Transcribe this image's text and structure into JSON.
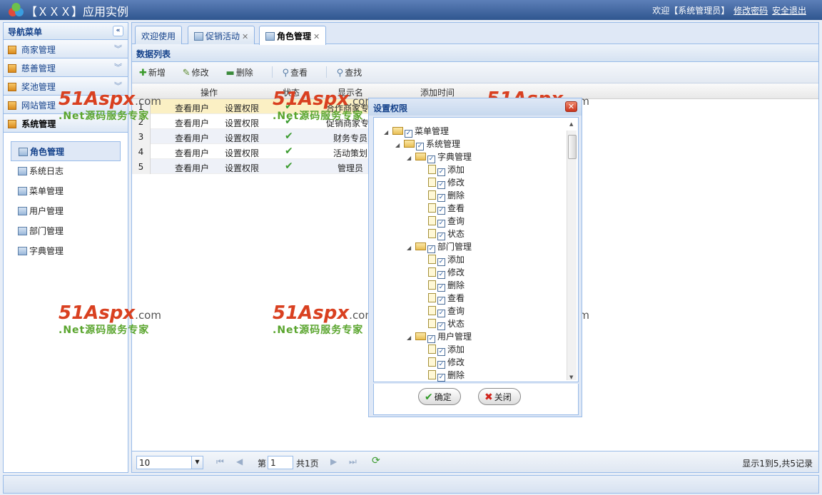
{
  "header": {
    "title": "【ＸＸＸ】应用实例",
    "welcome": "欢迎【系统管理员】",
    "change_password": "修改密码",
    "logout": "安全退出"
  },
  "west": {
    "title": "导航菜单",
    "accordion": [
      {
        "label": "商家管理"
      },
      {
        "label": "慈善管理"
      },
      {
        "label": "奖池管理"
      },
      {
        "label": "网站管理"
      },
      {
        "label": "系统管理"
      }
    ],
    "submenu": [
      {
        "label": "角色管理"
      },
      {
        "label": "系统日志"
      },
      {
        "label": "菜单管理"
      },
      {
        "label": "用户管理"
      },
      {
        "label": "部门管理"
      },
      {
        "label": "字典管理"
      }
    ]
  },
  "tabs": [
    {
      "label": "欢迎使用"
    },
    {
      "label": "促销活动"
    },
    {
      "label": "角色管理"
    }
  ],
  "panel": {
    "title": "数据列表"
  },
  "toolbar": {
    "add": "新增",
    "edit": "修改",
    "delete": "删除",
    "view": "查看",
    "search": "查找"
  },
  "grid": {
    "columns": {
      "op": "操作",
      "status": "状态",
      "name": "显示名",
      "time": "添加时间"
    },
    "rows": [
      {
        "num": "1",
        "view_users": "查看用户",
        "set_perm": "设置权限",
        "name": "合作商家专"
      },
      {
        "num": "2",
        "view_users": "查看用户",
        "set_perm": "设置权限",
        "name": "促销商家专"
      },
      {
        "num": "3",
        "view_users": "查看用户",
        "set_perm": "设置权限",
        "name": "财务专员"
      },
      {
        "num": "4",
        "view_users": "查看用户",
        "set_perm": "设置权限",
        "name": "活动策划"
      },
      {
        "num": "5",
        "view_users": "查看用户",
        "set_perm": "设置权限",
        "name": "管理员"
      }
    ]
  },
  "pager": {
    "page_size": "10",
    "page_prefix": "第",
    "current_page": "1",
    "page_suffix": "共1页",
    "summary": "显示1到5,共5记录"
  },
  "dialog": {
    "title": "设置权限",
    "tree": [
      {
        "label": "菜单管理",
        "level": 0,
        "type": "folder"
      },
      {
        "label": "系统管理",
        "level": 1,
        "type": "folder"
      },
      {
        "label": "字典管理",
        "level": 2,
        "type": "folder"
      },
      {
        "label": "添加",
        "level": 3,
        "type": "file"
      },
      {
        "label": "修改",
        "level": 3,
        "type": "file"
      },
      {
        "label": "删除",
        "level": 3,
        "type": "file"
      },
      {
        "label": "查看",
        "level": 3,
        "type": "file"
      },
      {
        "label": "查询",
        "level": 3,
        "type": "file"
      },
      {
        "label": "状态",
        "level": 3,
        "type": "file"
      },
      {
        "label": "部门管理",
        "level": 2,
        "type": "folder"
      },
      {
        "label": "添加",
        "level": 3,
        "type": "file"
      },
      {
        "label": "修改",
        "level": 3,
        "type": "file"
      },
      {
        "label": "删除",
        "level": 3,
        "type": "file"
      },
      {
        "label": "查看",
        "level": 3,
        "type": "file"
      },
      {
        "label": "查询",
        "level": 3,
        "type": "file"
      },
      {
        "label": "状态",
        "level": 3,
        "type": "file"
      },
      {
        "label": "用户管理",
        "level": 2,
        "type": "folder"
      },
      {
        "label": "添加",
        "level": 3,
        "type": "file"
      },
      {
        "label": "修改",
        "level": 3,
        "type": "file"
      },
      {
        "label": "删除",
        "level": 3,
        "type": "file"
      }
    ],
    "ok": "确定",
    "close": "关闭"
  },
  "watermark": {
    "brand": "51Aspx",
    "domain": ".com",
    "tagline": ".Net源码服务专家"
  }
}
